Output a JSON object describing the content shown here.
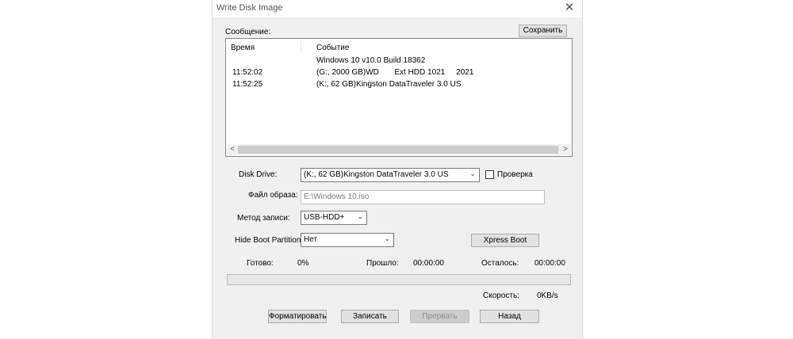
{
  "window": {
    "title": "Write Disk Image",
    "close_glyph": "✕"
  },
  "log": {
    "label": "Сообщение:",
    "save_button": "Сохранить",
    "columns": [
      "Время",
      "Событие"
    ],
    "rows": [
      {
        "time": "",
        "event": "Windows 10 v10.0 Build 18362"
      },
      {
        "time": "11:52:02",
        "event": "(G:, 2000 GB)WD       Ext HDD 1021     2021"
      },
      {
        "time": "11:52:25",
        "event": "(K:, 62 GB)Kingston DataTraveler 3.0 US"
      }
    ]
  },
  "form": {
    "disk_drive_label": "Disk Drive:",
    "disk_drive_value": "(K:, 62 GB)Kingston DataTraveler 3.0 US",
    "verify_label": "Проверка",
    "verify_checked": false,
    "image_file_label": "Файл образа:",
    "image_file_value": "E:\\Windows 10.iso",
    "write_method_label": "Метод записи:",
    "write_method_value": "USB-HDD+",
    "hide_boot_label": "Hide Boot Partition:",
    "hide_boot_value": "Нет",
    "xpress_boot_button": "Xpress Boot"
  },
  "progress": {
    "done_label": "Готово:",
    "done_value": "0%",
    "elapsed_label": "Прошло:",
    "elapsed_value": "00:00:00",
    "remaining_label": "Осталось:",
    "remaining_value": "00:00:00",
    "speed_label": "Скорость:",
    "speed_value": "0KB/s",
    "fraction": 0
  },
  "buttons": {
    "format": "Форматировать",
    "write": "Записать",
    "abort": "Прервать",
    "back": "Назад"
  }
}
